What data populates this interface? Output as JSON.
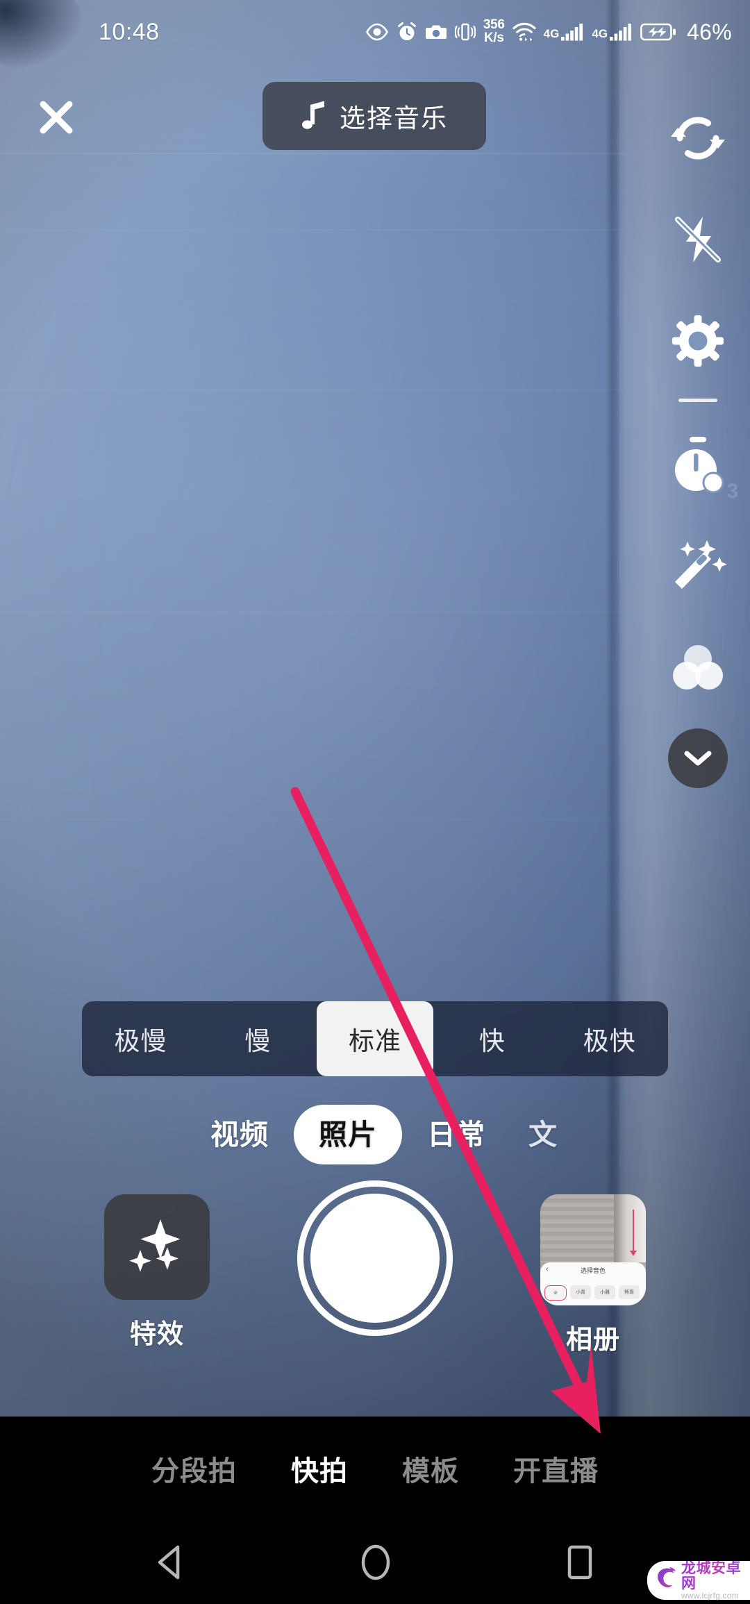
{
  "status_bar": {
    "time": "10:48",
    "net_speed_value": "356",
    "net_speed_unit": "K/s",
    "battery_text": "46%",
    "sim1_label": "4G",
    "sim2_label": "4G",
    "icons": [
      "eye-icon",
      "alarm-icon",
      "camera-icon",
      "vibrate-icon",
      "wifi-icon",
      "signal-icon",
      "signal-icon",
      "battery-charging-icon"
    ]
  },
  "top_bar": {
    "close_label": "close-icon",
    "music_button_label": "选择音乐",
    "music_icon": "music-note-icon"
  },
  "right_rail": {
    "items": [
      {
        "name": "flip-camera-icon",
        "label": "翻转"
      },
      {
        "name": "flash-off-icon",
        "label": "闪光灯关闭"
      },
      {
        "name": "settings-gear-icon",
        "label": "设置"
      },
      {
        "name": "timer-icon",
        "label": "倒计时",
        "badge": "3"
      },
      {
        "name": "beauty-wand-icon",
        "label": "美化"
      },
      {
        "name": "filters-icon",
        "label": "滤镜"
      }
    ],
    "collapse_icon": "chevron-down-icon"
  },
  "speed_bar": {
    "options": [
      "极慢",
      "慢",
      "标准",
      "快",
      "极快"
    ],
    "selected_index": 2
  },
  "mode_tabs": {
    "items": [
      "视频",
      "照片",
      "日常",
      "文"
    ],
    "selected_index": 1
  },
  "capture_row": {
    "effects_label": "特效",
    "effects_icon": "sparkles-icon",
    "shutter_label": "shutter-button",
    "album_label": "相册",
    "album_thumb": {
      "title": "选择音色",
      "back_icon": "chevron-left-icon",
      "chips": [
        "",
        "小青",
        "小雅",
        "熊哥"
      ]
    }
  },
  "bottom_nav": {
    "items": [
      "分段拍",
      "快拍",
      "模板",
      "开直播"
    ],
    "selected_index": 1
  },
  "android_nav": {
    "back": "back-triangle-icon",
    "home": "home-circle-icon",
    "recents": "recents-square-icon"
  },
  "watermark": {
    "title": "龙城安卓网",
    "url": "www.lcjrfg.com"
  },
  "colors": {
    "annotation_pink": "#e8205f",
    "accent_white": "#ffffff",
    "panel_dark": "rgba(28,36,58,0.78)",
    "preview_blue": "#7089b4",
    "nav_inactive": "#8c8c8c"
  }
}
